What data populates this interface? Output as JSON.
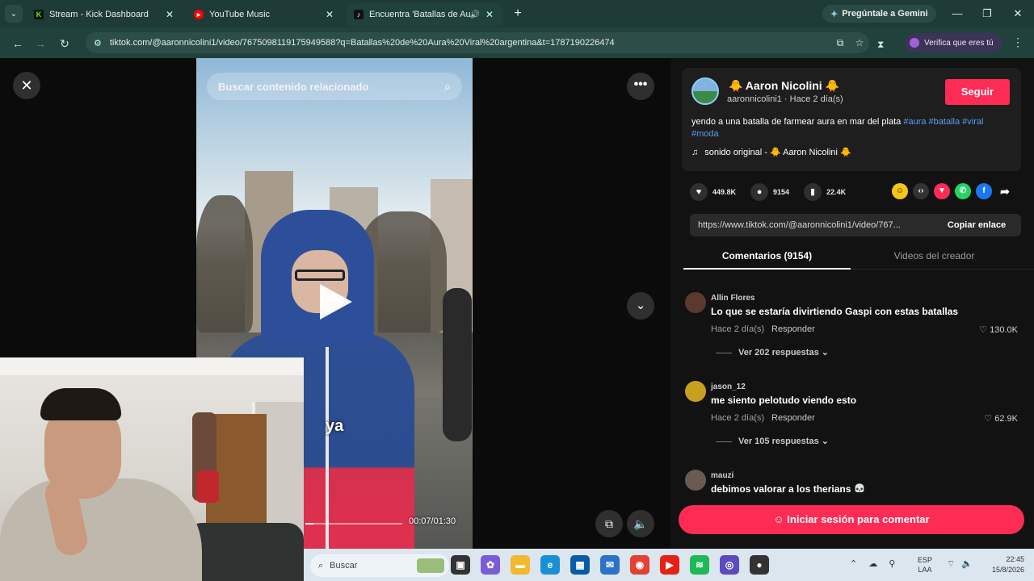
{
  "browser": {
    "tabs": [
      {
        "label": "Stream - Kick Dashboard",
        "favicon": "K",
        "color": "#53fc18"
      },
      {
        "label": "YouTube Music",
        "favicon": "▶",
        "color": "#ff0000"
      },
      {
        "label": "Encuentra 'Batallas de Aura'",
        "favicon": "♪",
        "color": "#111111"
      }
    ],
    "gemini_label": "Pregúntale a Gemini",
    "url": "tiktok.com/@aaronnicolini1/video/7675098119175949588?q=Batallas%20de%20Aura%20Viral%20argentina&t=1787190226474",
    "verify_label": "Verifica que eres tú"
  },
  "video": {
    "search_placeholder": "Buscar contenido relacionado",
    "subtitle": "ya",
    "time": "00:07/01:30",
    "progress": 0.08
  },
  "post": {
    "author_name": "🐥 Aaron Nicolini 🐥",
    "author_meta": "aaronnicolini1 · Hace 2 día(s)",
    "follow_label": "Seguir",
    "caption_text": "yendo a una batalla de farmear aura en mar del plata ",
    "hashtags": [
      "#aura",
      "#batalla",
      "#viral",
      "#moda"
    ],
    "music": "sonido original - 🐥 Aaron Nicolini 🐥",
    "likes": "449.8K",
    "comments_count": "9154",
    "saves": "22.4K",
    "link": "https://www.tiktok.com/@aaronnicolini1/video/767...",
    "copy_label": "Copiar enlace"
  },
  "tabs": {
    "comments": "Comentarios (9154)",
    "creator": "Videos del creador"
  },
  "comments": [
    {
      "user": "Allin Flores",
      "text": "Lo que se estaría divirtiendo Gaspi con estas batallas",
      "time": "Hace 2 día(s)",
      "reply": "Responder",
      "likes": "130.0K",
      "more": "Ver 202 respuestas"
    },
    {
      "user": "jason_12",
      "text": "me siento pelotudo viendo esto",
      "time": "Hace 2 día(s)",
      "reply": "Responder",
      "likes": "62.9K",
      "more": "Ver 105 respuestas"
    },
    {
      "user": "mauzi",
      "text": "debimos valorar a los therians 💀",
      "time": "",
      "reply": "",
      "likes": "",
      "more": ""
    }
  ],
  "login_label": "Iniciar sesión para comentar",
  "taskbar": {
    "search_placeholder": "Buscar",
    "lang_1": "ESP",
    "lang_2": "LAA",
    "time": "22:45",
    "date": "15/8/2026"
  },
  "colors": {
    "accent": "#fe2c55",
    "hashtag": "#5d9cf2",
    "chrome": "#20413c"
  }
}
